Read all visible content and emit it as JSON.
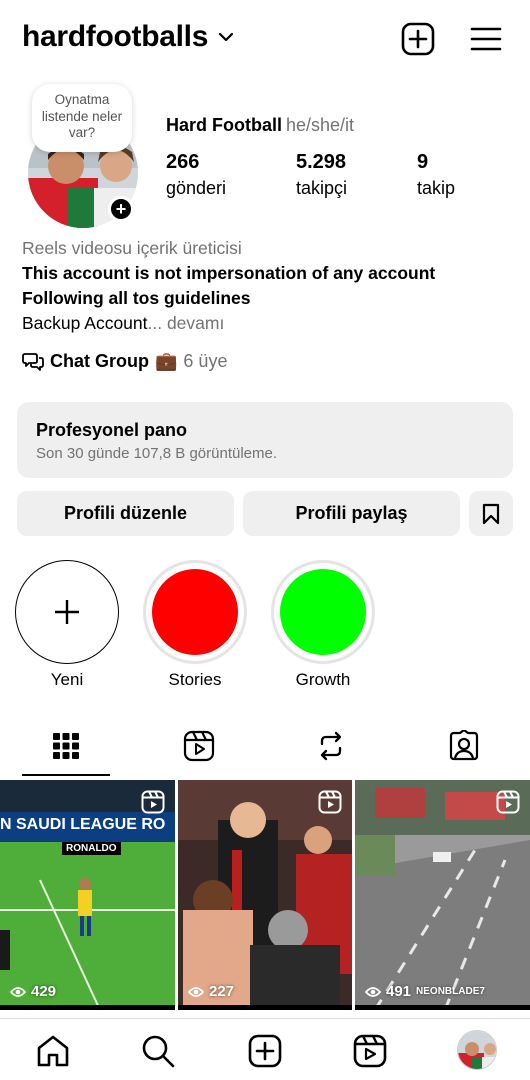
{
  "header": {
    "username": "hardfootballs"
  },
  "profile": {
    "note": "Oynatma listende neler var?",
    "display_name": "Hard Football",
    "pronouns": "he/she/it",
    "stats": [
      {
        "value": "266",
        "label": "gönderi"
      },
      {
        "value": "5.298",
        "label": "takipçi"
      },
      {
        "value": "9",
        "label": "takip"
      }
    ],
    "bio": {
      "category": "Reels videosu içerik üreticisi",
      "line1": "This account is not impersonation of any account",
      "line2": "Following all tos guidelines",
      "line3": "Backup Account",
      "more": "... devamı"
    },
    "chat": {
      "title": "Chat Group",
      "emoji": "💼",
      "members": "6 üye"
    }
  },
  "dashboard": {
    "title": "Profesyonel pano",
    "subtitle": "Son 30 günde 107,8 B görüntüleme."
  },
  "buttons": {
    "edit": "Profili düzenle",
    "share": "Profili paylaş"
  },
  "highlights": [
    {
      "label": "Yeni",
      "color": "#ffffff"
    },
    {
      "label": "Stories",
      "color": "#ff0000"
    },
    {
      "label": "Growth",
      "color": "#00ff00"
    }
  ],
  "tabs": [
    "grid-icon",
    "reels-icon",
    "repost-icon",
    "tagged-icon"
  ],
  "posts": [
    {
      "views": "429",
      "overlay": "RONALDO"
    },
    {
      "views": "227",
      "overlay": ""
    },
    {
      "views": "491",
      "overlay": "NEONBLADE7"
    }
  ],
  "post_banner": "N SAUDI LEAGUE RO",
  "bottom_nav": [
    "home-icon",
    "search-icon",
    "create-icon",
    "reels-icon",
    "profile-avatar"
  ]
}
